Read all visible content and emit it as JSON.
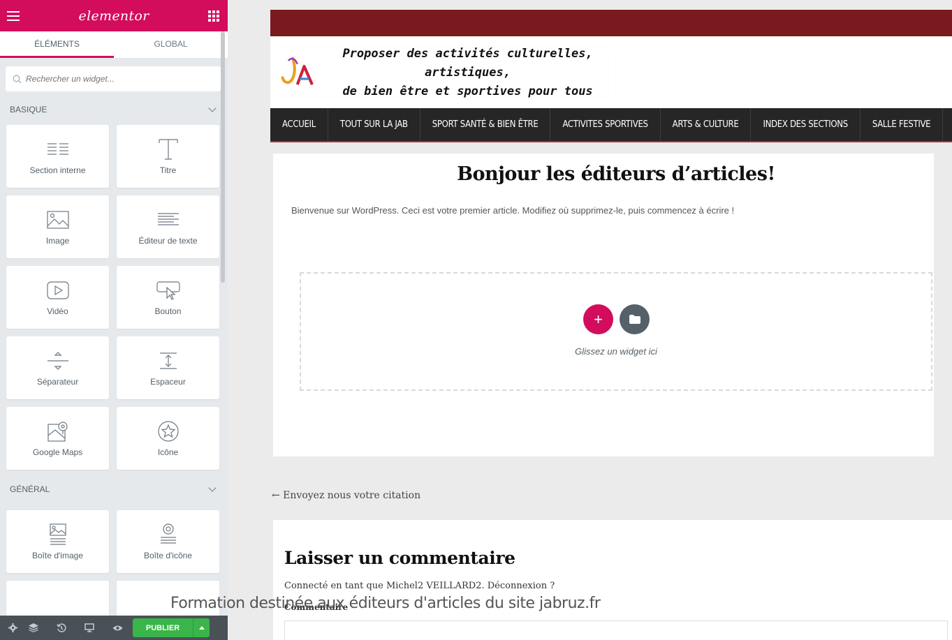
{
  "editor": {
    "logo": "elementor",
    "tabs": [
      {
        "label": "ÉLÉMENTS",
        "active": true
      },
      {
        "label": "GLOBAL",
        "active": false
      }
    ],
    "search": {
      "placeholder": "Rechercher un widget..."
    },
    "categories": [
      {
        "name": "BASIQUE",
        "widgets": [
          {
            "label": "Section interne",
            "icon": "inner-section-icon"
          },
          {
            "label": "Titre",
            "icon": "heading-icon"
          },
          {
            "label": "Image",
            "icon": "image-icon"
          },
          {
            "label": "Éditeur de texte",
            "icon": "text-editor-icon"
          },
          {
            "label": "Vidéo",
            "icon": "video-icon"
          },
          {
            "label": "Bouton",
            "icon": "button-icon"
          },
          {
            "label": "Séparateur",
            "icon": "divider-icon"
          },
          {
            "label": "Espaceur",
            "icon": "spacer-icon"
          },
          {
            "label": "Google Maps",
            "icon": "map-icon"
          },
          {
            "label": "Icône",
            "icon": "star-icon"
          }
        ]
      },
      {
        "name": "GÉNÉRAL",
        "widgets": [
          {
            "label": "Boîte d'image",
            "icon": "image-box-icon"
          },
          {
            "label": "Boîte d'icône",
            "icon": "icon-box-icon"
          }
        ]
      }
    ],
    "footer": {
      "publish_label": "PUBLIER"
    },
    "colors": {
      "accent": "#d30c5c",
      "publish": "#39b54a",
      "footer": "#495157"
    }
  },
  "site": {
    "tagline": "Proposer des activités culturelles, artistiques,\nde bien être et sportives pour tous",
    "nav": [
      "ACCUEIL",
      "TOUT SUR LA JAB",
      "SPORT SANTÉ & BIEN ÊTRE",
      "ACTIVITES SPORTIVES",
      "ARTS & CULTURE",
      "INDEX DES SECTIONS",
      "SALLE FESTIVE"
    ],
    "article": {
      "title": "Bonjour les éditeurs d’articles!",
      "body": "Bienvenue sur WordPress. Ceci est votre premier article. Modifiez où supprimez-le, puis commencez à écrire !",
      "dropzone_text": "Glissez un widget ici"
    },
    "prev_link": "← Envoyez nous votre citation",
    "comments": {
      "title": "Laisser un commentaire",
      "logged_in": "Connecté en tant que Michel2 VEILLARD2. Déconnexion ?",
      "label": "Commentaire"
    },
    "colors": {
      "topbar": "#7a1a1e",
      "nav": "#262626"
    }
  },
  "caption": "Formation destinée aux éditeurs d'articles du site jabruz.fr"
}
